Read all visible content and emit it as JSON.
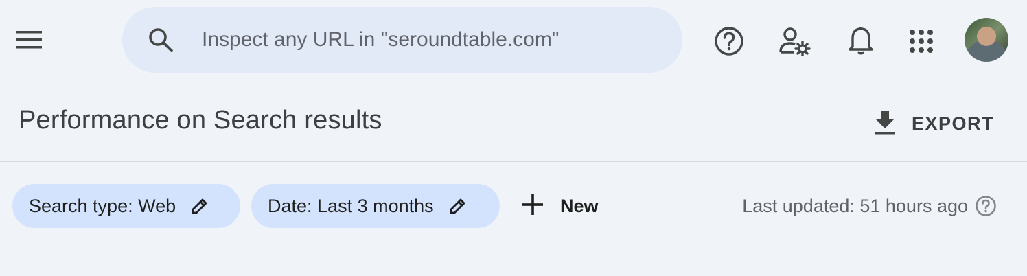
{
  "search": {
    "placeholder": "Inspect any URL in \"seroundtable.com\""
  },
  "topbar_icons": [
    "menu-icon",
    "search-icon",
    "help-icon",
    "manage-users-icon",
    "notifications-icon",
    "apps-grid-icon",
    "avatar"
  ],
  "header": {
    "title": "Performance on Search results",
    "export_label": "EXPORT"
  },
  "filters": {
    "chips": [
      {
        "label": "Search type: Web"
      },
      {
        "label": "Date: Last 3 months"
      }
    ],
    "new_label": "New",
    "last_updated": "Last updated: 51 hours ago"
  },
  "colors": {
    "background": "#f0f4f9",
    "search_bg": "#e3eaf7",
    "chip_bg": "#d3e3fd",
    "text_dark": "#3c4043",
    "text_muted": "#5f6368"
  }
}
